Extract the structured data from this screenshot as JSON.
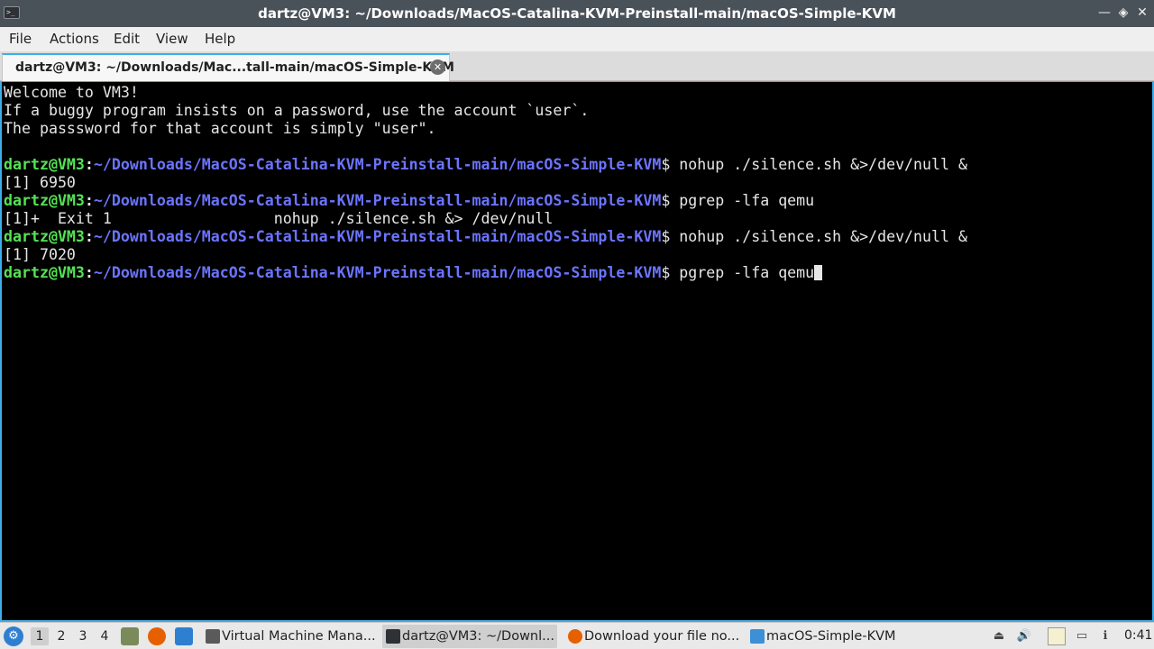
{
  "window": {
    "title": "dartz@VM3: ~/Downloads/MacOS-Catalina-KVM-Preinstall-main/macOS-Simple-KVM",
    "controls": {
      "minimize": "—",
      "maximize": "◈",
      "close": "✕"
    }
  },
  "menubar": {
    "items": [
      "File",
      "Actions",
      "Edit",
      "View",
      "Help"
    ]
  },
  "tab": {
    "label": "dartz@VM3: ~/Downloads/Mac...tall-main/macOS-Simple-KVM",
    "close": "✕"
  },
  "prompt": {
    "user": "dartz@VM3",
    "sep": ":",
    "path": "~/Downloads/MacOS-Catalina-KVM-Preinstall-main/macOS-Simple-KVM",
    "symbol": "$ "
  },
  "terminal": {
    "lines": [
      {
        "type": "out",
        "text": "Welcome to VM3!"
      },
      {
        "type": "out",
        "text": "If a buggy program insists on a password, use the account `user`."
      },
      {
        "type": "out",
        "text": "The passsword for that account is simply \"user\"."
      },
      {
        "type": "out",
        "text": ""
      },
      {
        "type": "prompt",
        "cmd": "nohup ./silence.sh &>/dev/null &"
      },
      {
        "type": "out",
        "text": "[1] 6950"
      },
      {
        "type": "prompt",
        "cmd": "pgrep -lfa qemu"
      },
      {
        "type": "out",
        "text": "[1]+  Exit 1                  nohup ./silence.sh &> /dev/null"
      },
      {
        "type": "prompt",
        "cmd": "nohup ./silence.sh &>/dev/null &"
      },
      {
        "type": "out",
        "text": "[1] 7020"
      },
      {
        "type": "prompt",
        "cmd": "pgrep -lfa qemu",
        "cursor": true
      }
    ]
  },
  "taskbar": {
    "start_icon": "start-menu-icon",
    "desktops": [
      "1",
      "2",
      "3",
      "4"
    ],
    "active_desktop": "1",
    "tasks": [
      {
        "label": "Virtual Machine Mana...",
        "icon": "virt-manager-icon",
        "color": "#5a5a5a"
      },
      {
        "label": "dartz@VM3: ~/Downl...",
        "icon": "terminal-icon",
        "color": "#2e3236"
      },
      {
        "label": "Download your file no...",
        "icon": "firefox-icon",
        "color": "#e66000"
      },
      {
        "label": "macOS-Simple-KVM",
        "icon": "folder-icon",
        "color": "#3d8fd6"
      }
    ],
    "clock": "0:41"
  },
  "colors": {
    "accent": "#3daee9",
    "prompt_user": "#54e354",
    "prompt_path": "#6b74ff",
    "terminal_bg": "#000000"
  }
}
